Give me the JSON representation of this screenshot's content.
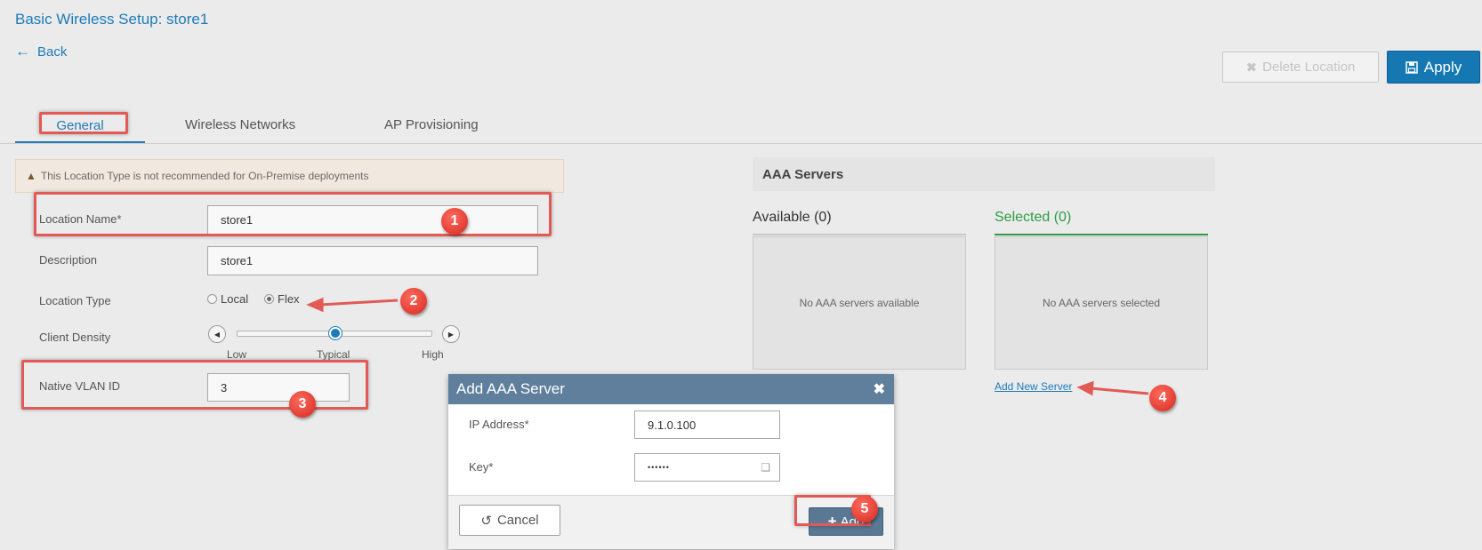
{
  "header": {
    "title": "Basic Wireless Setup: store1",
    "back_label": "Back",
    "delete_label": "Delete Location",
    "apply_label": "Apply"
  },
  "tabs": [
    {
      "label": "General",
      "active": true
    },
    {
      "label": "Wireless Networks",
      "active": false
    },
    {
      "label": "AP Provisioning",
      "active": false
    }
  ],
  "warning": "This Location Type is not recommended for On-Premise deployments",
  "form": {
    "location_name_label": "Location Name*",
    "location_name_value": "store1",
    "description_label": "Description",
    "description_value": "store1",
    "location_type_label": "Location Type",
    "location_type_options": [
      "Local",
      "Flex"
    ],
    "location_type_selected": "Flex",
    "client_density_label": "Client Density",
    "density_ticks": [
      "Low",
      "Typical",
      "High"
    ],
    "density_value": "Typical",
    "native_vlan_label": "Native VLAN ID",
    "native_vlan_value": "3"
  },
  "aaa": {
    "title": "AAA Servers",
    "available_label": "Available (0)",
    "selected_label": "Selected (0)",
    "available_empty": "No AAA servers available",
    "selected_empty": "No AAA servers selected",
    "add_new_label": "Add New Server"
  },
  "modal": {
    "title": "Add AAA Server",
    "ip_label": "IP Address*",
    "ip_value": "9.1.0.100",
    "key_label": "Key*",
    "key_value": "••••••",
    "cancel_label": "Cancel",
    "add_label": "Add"
  },
  "annotations": [
    "1",
    "2",
    "3",
    "4",
    "5"
  ],
  "colors": {
    "accent": "#1d7bb8",
    "highlight": "#e15a55",
    "selected_green": "#2c9c43",
    "modal_header": "#5f7f9c"
  }
}
